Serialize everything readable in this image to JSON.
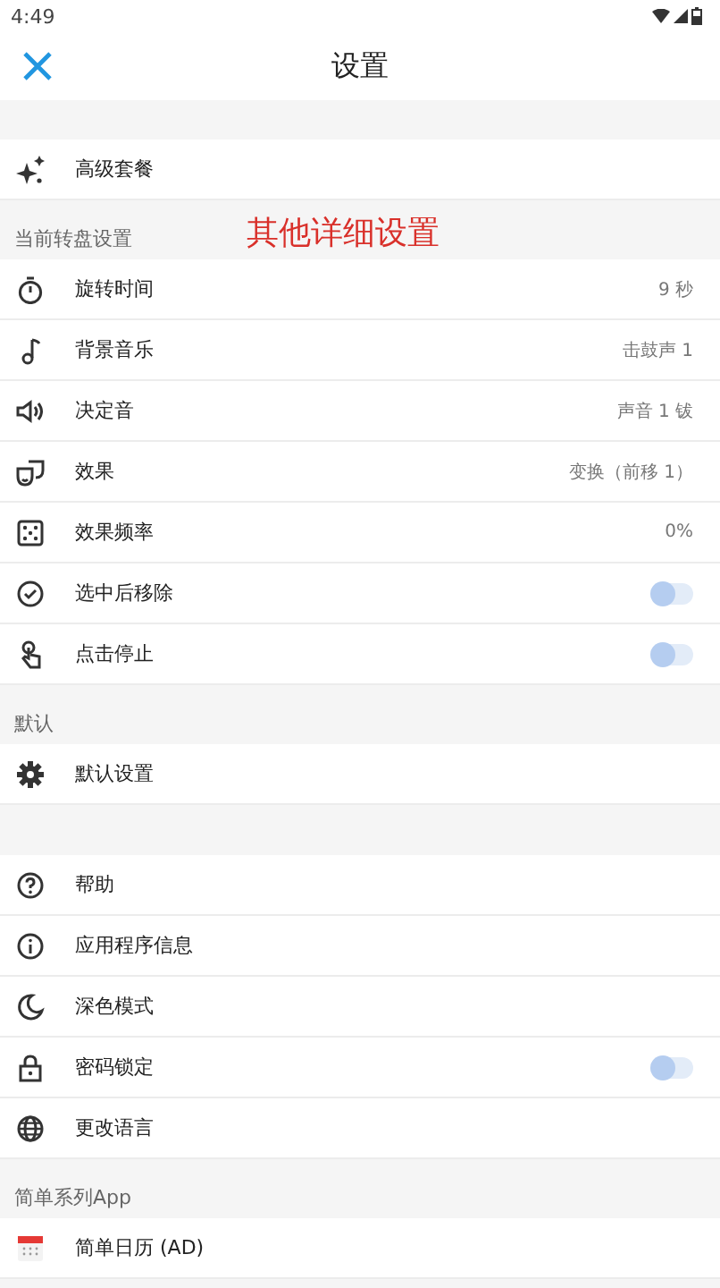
{
  "status_bar": {
    "time": "4:49"
  },
  "app_bar": {
    "title": "设置"
  },
  "sections": [
    {
      "items": [
        {
          "kind": "link",
          "label": "高级套餐"
        }
      ]
    },
    {
      "header": "当前转盘设置",
      "annotation": "其他详细设置",
      "items": [
        {
          "kind": "value",
          "label": "旋转时间",
          "value": "9 秒"
        },
        {
          "kind": "value",
          "label": "背景音乐",
          "value": "击鼓声 1"
        },
        {
          "kind": "value",
          "label": "决定音",
          "value": "声音 1 钹"
        },
        {
          "kind": "value",
          "label": "效果",
          "value": "变换（前移 1）"
        },
        {
          "kind": "value",
          "label": "效果频率",
          "value": "0%"
        },
        {
          "kind": "toggle",
          "label": "选中后移除",
          "on": false
        },
        {
          "kind": "toggle",
          "label": "点击停止",
          "on": false
        }
      ]
    },
    {
      "header": "默认",
      "items": [
        {
          "kind": "link",
          "label": "默认设置"
        }
      ]
    },
    {
      "items": [
        {
          "kind": "link",
          "label": "帮助"
        },
        {
          "kind": "link",
          "label": "应用程序信息"
        },
        {
          "kind": "link",
          "label": "深色模式"
        },
        {
          "kind": "toggle",
          "label": "密码锁定",
          "on": false
        },
        {
          "kind": "link",
          "label": "更改语言"
        }
      ]
    },
    {
      "header": "简单系列App",
      "items": [
        {
          "kind": "link",
          "label": "简单日历 (AD)"
        }
      ]
    }
  ]
}
